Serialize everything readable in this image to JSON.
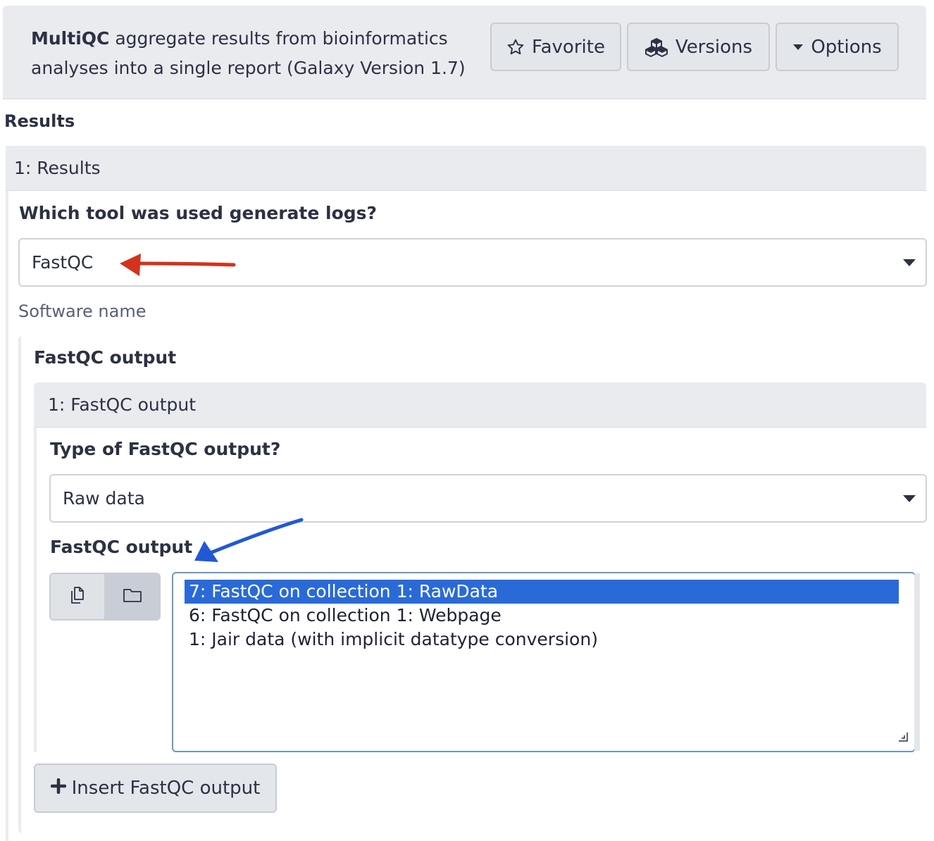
{
  "header": {
    "tool_name": "MultiQC",
    "tool_description": "aggregate results from bioinformatics analyses into a single report (Galaxy Version 1.7)",
    "favorite_label": "Favorite",
    "versions_label": "Versions",
    "options_label": "Options"
  },
  "results": {
    "section_title": "Results",
    "repeat_title": "1: Results",
    "tool_question": "Which tool was used generate logs?",
    "tool_value": "FastQC",
    "tool_help": "Software name",
    "fastqc": {
      "section_title": "FastQC output",
      "repeat_title": "1: FastQC output",
      "type_question": "Type of FastQC output?",
      "type_value": "Raw data",
      "output_label": "FastQC output",
      "options": [
        "7: FastQC on collection 1: RawData",
        "6: FastQC on collection 1: Webpage",
        "1: Jair data (with implicit datatype conversion)"
      ],
      "selected_index": 0,
      "insert_label": "Insert FastQC output"
    }
  },
  "icons": {
    "favorite": "star-icon",
    "versions": "cubes-icon",
    "options": "caret-down-icon",
    "multi_dataset": "copy-icon",
    "collection": "folder-icon",
    "insert": "plus-icon"
  },
  "annotations": {
    "red_arrow_color": "#d2331c",
    "blue_arrow_color": "#2158d6"
  }
}
